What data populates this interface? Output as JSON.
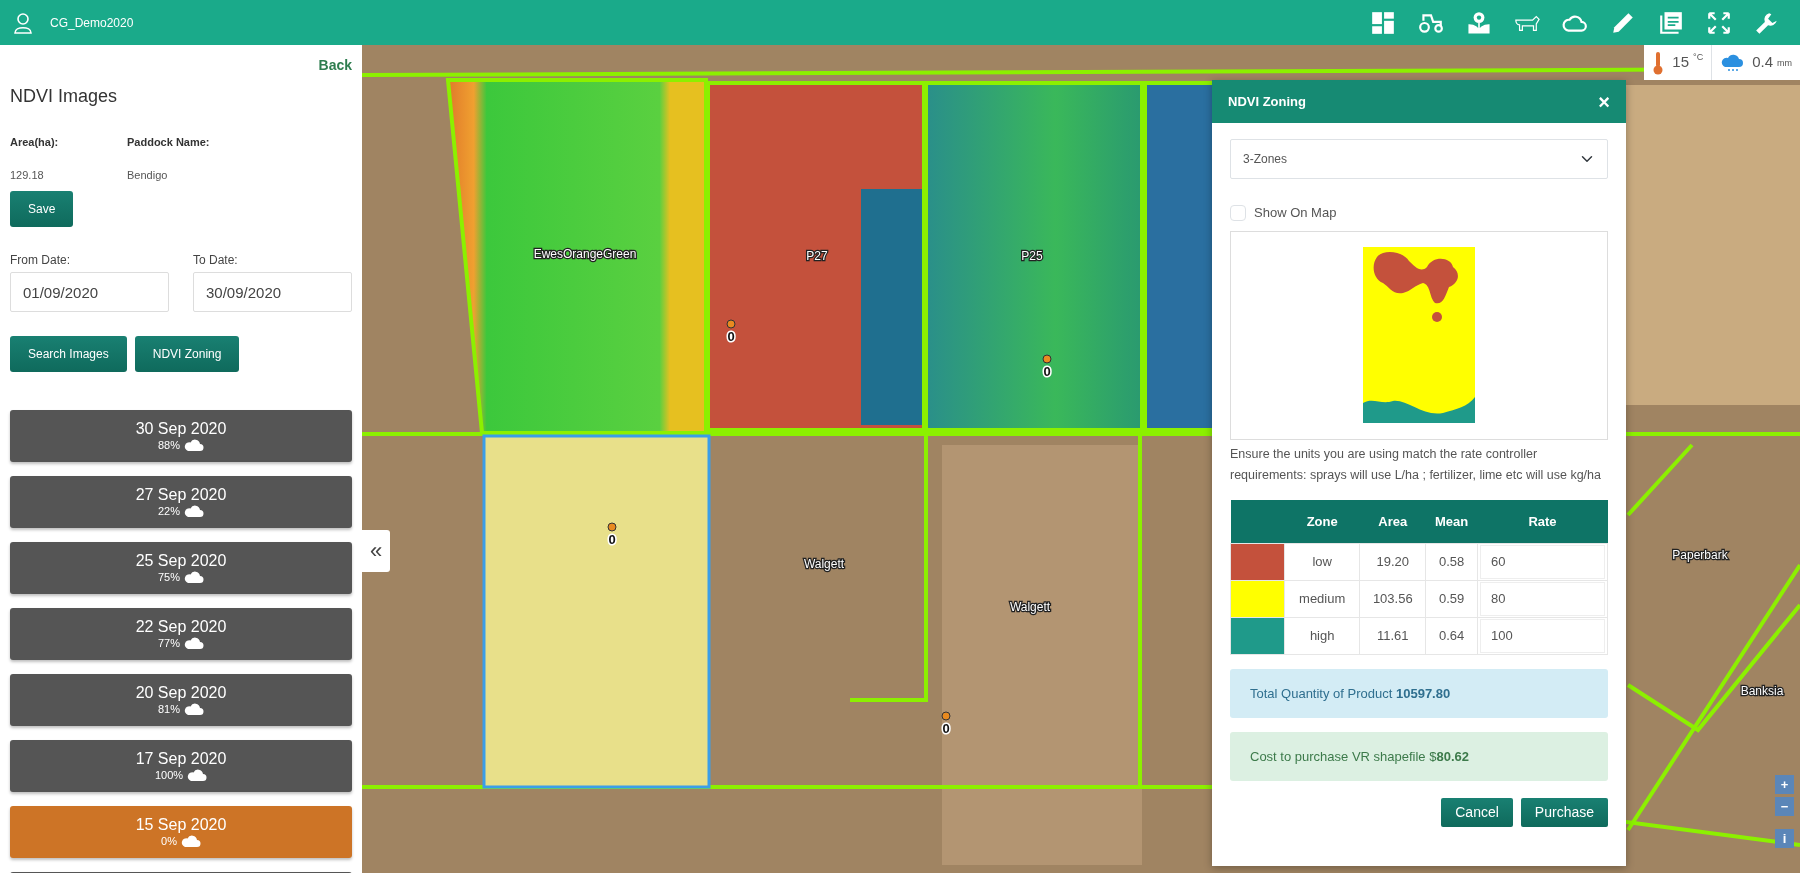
{
  "app_bar": {
    "account": "CG_Demo2020"
  },
  "weather": {
    "temperature": "15",
    "temperature_unit": "°C",
    "rainfall": "0.4",
    "rainfall_unit": "mm"
  },
  "sidebar": {
    "back": "Back",
    "title": "NDVI Images",
    "fields": [
      {
        "label": "Area(ha):",
        "value": "129.18"
      },
      {
        "label": "Paddock Name:",
        "value": "Bendigo"
      }
    ],
    "save": "Save",
    "from_date": {
      "label": "From Date:",
      "value": "01/09/2020"
    },
    "to_date": {
      "label": "To Date:",
      "value": "30/09/2020"
    },
    "actions": [
      "Search Images",
      "NDVI Zoning"
    ],
    "images": [
      {
        "date": "30 Sep 2020",
        "cloud": "88%",
        "selected": false
      },
      {
        "date": "27 Sep 2020",
        "cloud": "22%",
        "selected": false
      },
      {
        "date": "25 Sep 2020",
        "cloud": "75%",
        "selected": false
      },
      {
        "date": "22 Sep 2020",
        "cloud": "77%",
        "selected": false
      },
      {
        "date": "20 Sep 2020",
        "cloud": "81%",
        "selected": false
      },
      {
        "date": "17 Sep 2020",
        "cloud": "100%",
        "selected": false
      },
      {
        "date": "15 Sep 2020",
        "cloud": "0%",
        "selected": true
      }
    ]
  },
  "map": {
    "collapse": "«",
    "paddock_labels": [
      "EwesOrangeGreen",
      "P27",
      "P25",
      "Walgett",
      "Walgett",
      "Paperbark",
      "Banksia"
    ],
    "markers": [
      "0",
      "0",
      "0",
      "0"
    ],
    "controls": [
      "+",
      "−",
      "i"
    ]
  },
  "dialog": {
    "title": "NDVI Zoning",
    "close": "×",
    "zones_select": "3-Zones",
    "show_on_map": {
      "label": "Show On Map",
      "checked": false
    },
    "note": "Ensure the units you are using match the rate controller requirements: sprays will use L/ha ; fertilizer, lime etc will use kg/ha",
    "table": {
      "columns": [
        "Zone",
        "Area",
        "Mean",
        "Rate"
      ],
      "rows": [
        {
          "color": "#c4513c",
          "zone": "low",
          "area": "19.20",
          "mean": "0.58",
          "rate": "60"
        },
        {
          "color": "#ffff00",
          "zone": "medium",
          "area": "103.56",
          "mean": "0.59",
          "rate": "80"
        },
        {
          "color": "#1f9a8a",
          "zone": "high",
          "area": "11.61",
          "mean": "0.64",
          "rate": "100"
        }
      ]
    },
    "total": "Total Quantity of Product **10597.80**",
    "cost": "Cost to purchase VR shapefile $**80.62**",
    "buttons": [
      "Cancel",
      "Purchase"
    ]
  }
}
